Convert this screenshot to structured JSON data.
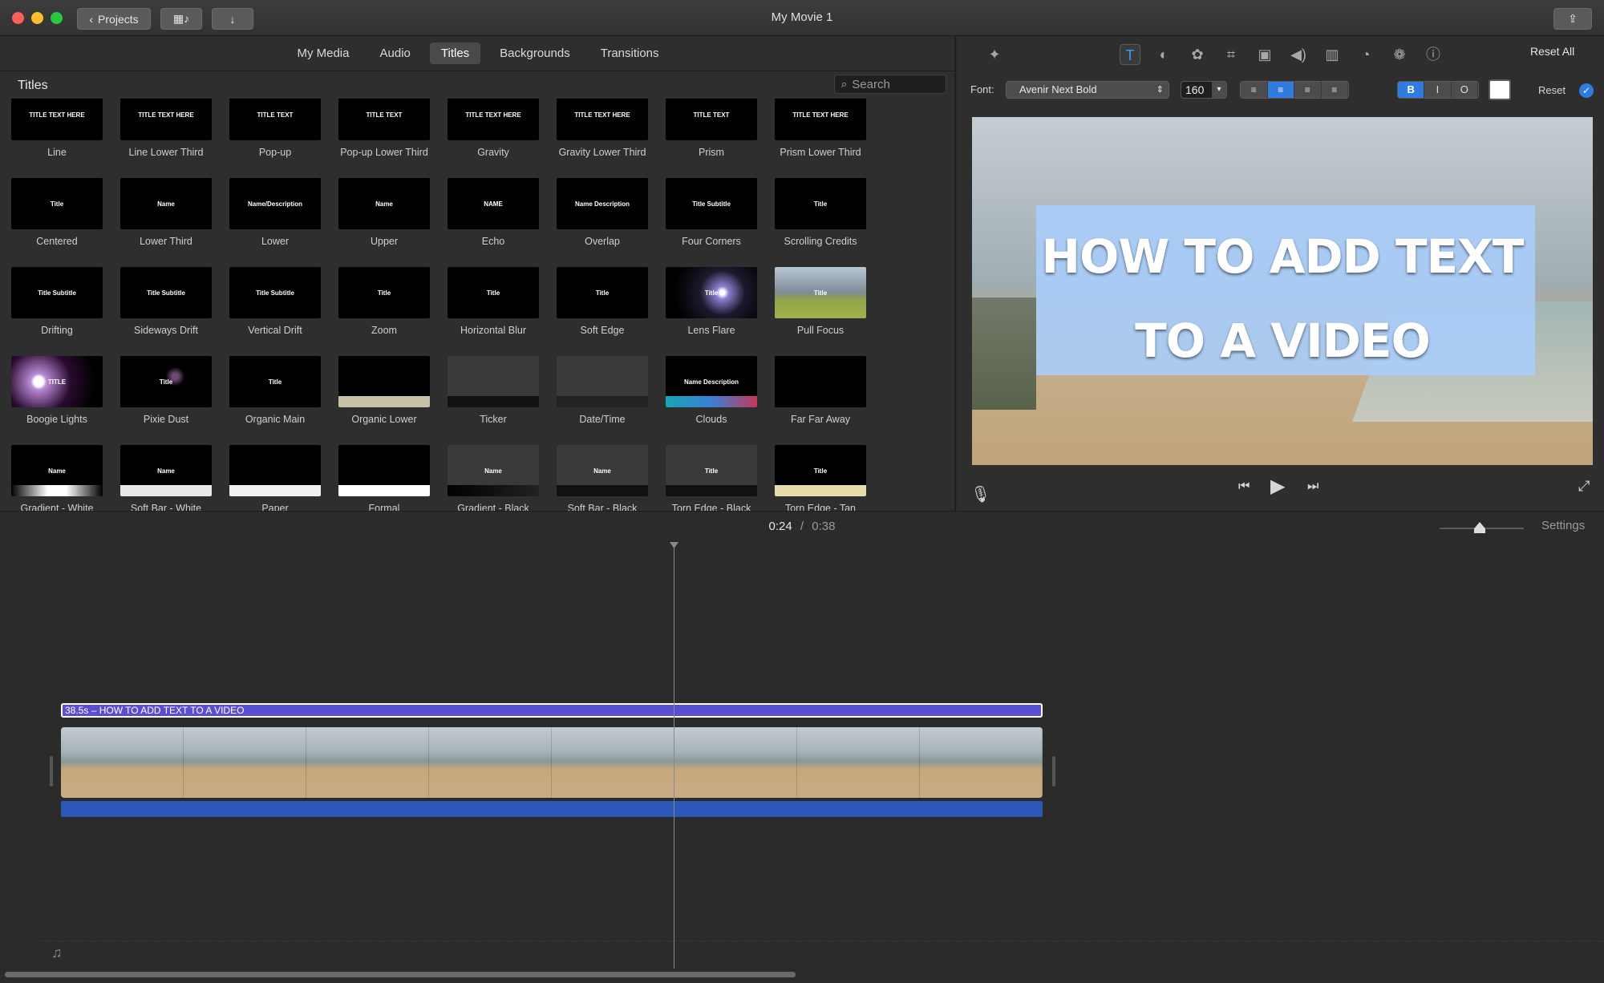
{
  "window": {
    "title": "My Movie 1",
    "projects_label": "Projects"
  },
  "media_tabs": [
    {
      "label": "My Media"
    },
    {
      "label": "Audio"
    },
    {
      "label": "Titles"
    },
    {
      "label": "Backgrounds"
    },
    {
      "label": "Transitions"
    }
  ],
  "browser": {
    "heading": "Titles",
    "search_placeholder": "Search"
  },
  "titles": [
    {
      "label": "Line",
      "mini": "TITLE TEXT HERE"
    },
    {
      "label": "Line Lower Third",
      "mini": "TITLE TEXT HERE"
    },
    {
      "label": "Pop-up",
      "mini": "TITLE TEXT"
    },
    {
      "label": "Pop-up Lower Third",
      "mini": "TITLE TEXT"
    },
    {
      "label": "Gravity",
      "mini": "TITLE TEXT HERE"
    },
    {
      "label": "Gravity Lower Third",
      "mini": "TITLE TEXT HERE"
    },
    {
      "label": "Prism",
      "mini": "TITLE TEXT"
    },
    {
      "label": "Prism Lower Third",
      "mini": "TITLE TEXT HERE"
    },
    {
      "label": "Centered",
      "mini": "Title"
    },
    {
      "label": "Lower Third",
      "mini": "Name"
    },
    {
      "label": "Lower",
      "mini": "Name/Description"
    },
    {
      "label": "Upper",
      "mini": "Name"
    },
    {
      "label": "Echo",
      "mini": "NAME"
    },
    {
      "label": "Overlap",
      "mini": "Name Description"
    },
    {
      "label": "Four Corners",
      "mini": "Title Subtitle"
    },
    {
      "label": "Scrolling Credits",
      "mini": "Title"
    },
    {
      "label": "Drifting",
      "mini": "Title Subtitle"
    },
    {
      "label": "Sideways Drift",
      "mini": "Title Subtitle"
    },
    {
      "label": "Vertical Drift",
      "mini": "Title Subtitle"
    },
    {
      "label": "Zoom",
      "mini": "Title"
    },
    {
      "label": "Horizontal Blur",
      "mini": "Title"
    },
    {
      "label": "Soft Edge",
      "mini": "Title"
    },
    {
      "label": "Lens Flare",
      "mini": "Title"
    },
    {
      "label": "Pull Focus",
      "mini": "Title"
    },
    {
      "label": "Boogie Lights",
      "mini": "TITLE"
    },
    {
      "label": "Pixie Dust",
      "mini": "Title"
    },
    {
      "label": "Organic Main",
      "mini": "Title"
    },
    {
      "label": "Organic Lower",
      "mini": ""
    },
    {
      "label": "Ticker",
      "mini": ""
    },
    {
      "label": "Date/Time",
      "mini": ""
    },
    {
      "label": "Clouds",
      "mini": "Name Description"
    },
    {
      "label": "Far Far Away",
      "mini": ""
    },
    {
      "label": "Gradient - White",
      "mini": "Name"
    },
    {
      "label": "Soft Bar - White",
      "mini": "Name"
    },
    {
      "label": "Paper",
      "mini": ""
    },
    {
      "label": "Formal",
      "mini": ""
    },
    {
      "label": "Gradient - Black",
      "mini": "Name"
    },
    {
      "label": "Soft Bar - Black",
      "mini": "Name"
    },
    {
      "label": "Torn Edge - Black",
      "mini": "Title"
    },
    {
      "label": "Torn Edge - Tan",
      "mini": "Title"
    }
  ],
  "inspector": {
    "reset_all": "Reset All",
    "font_label": "Font:",
    "font_value": "Avenir Next Bold",
    "size_value": "160",
    "reset": "Reset",
    "bold": "B",
    "italic": "I",
    "outline": "O"
  },
  "viewer": {
    "line1": "HOW TO ADD TEXT",
    "line2": "TO A VIDEO"
  },
  "timeline": {
    "current": "0:24",
    "separator": "/",
    "total": "0:38",
    "settings": "Settings",
    "title_clip": "38.5s – HOW TO ADD TEXT TO A VIDEO"
  },
  "colors": {
    "accent": "#2f7be0",
    "title_clip": "#5a4ed0",
    "audio": "#2b58b6"
  }
}
